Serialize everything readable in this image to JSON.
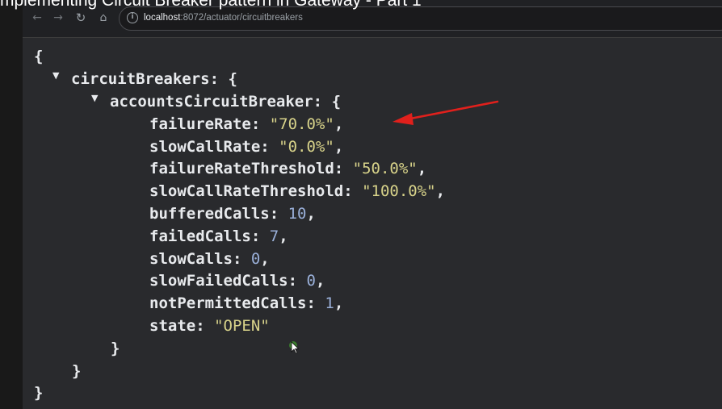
{
  "video": {
    "title": "mplementing Circuit Breaker pattern in Gateway - Part 1"
  },
  "browser": {
    "nav": {
      "back_glyph": "←",
      "forward_glyph": "→",
      "reload_glyph": "↻",
      "home_glyph": "⌂"
    },
    "address": {
      "host": "localhost",
      "rest": ":8072/actuator/circuitbreakers"
    }
  },
  "json_view": {
    "open_brace": "{",
    "close_brace": "}",
    "circuit_breakers_key": "circuitBreakers",
    "accounts_key": "accountsCircuitBreaker",
    "fields": [
      {
        "key": "failureRate",
        "value": "\"70.0%\"",
        "type": "string"
      },
      {
        "key": "slowCallRate",
        "value": "\"0.0%\"",
        "type": "string"
      },
      {
        "key": "failureRateThreshold",
        "value": "\"50.0%\"",
        "type": "string"
      },
      {
        "key": "slowCallRateThreshold",
        "value": "\"100.0%\"",
        "type": "string"
      },
      {
        "key": "bufferedCalls",
        "value": "10",
        "type": "number"
      },
      {
        "key": "failedCalls",
        "value": "7",
        "type": "number"
      },
      {
        "key": "slowCalls",
        "value": "0",
        "type": "number"
      },
      {
        "key": "slowFailedCalls",
        "value": "0",
        "type": "number"
      },
      {
        "key": "notPermittedCalls",
        "value": "1",
        "type": "number"
      },
      {
        "key": "state",
        "value": "\"OPEN\"",
        "type": "string"
      }
    ]
  },
  "colors": {
    "string_value": "#d8d38a",
    "number_value": "#9ab0d9",
    "annotation_arrow": "#e0201c"
  },
  "icons": [
    "back-arrow-icon",
    "forward-arrow-icon",
    "reload-icon",
    "home-icon",
    "info-icon",
    "triangle-expanded-icon",
    "red-annotation-arrow",
    "mouse-cursor-icon"
  ]
}
